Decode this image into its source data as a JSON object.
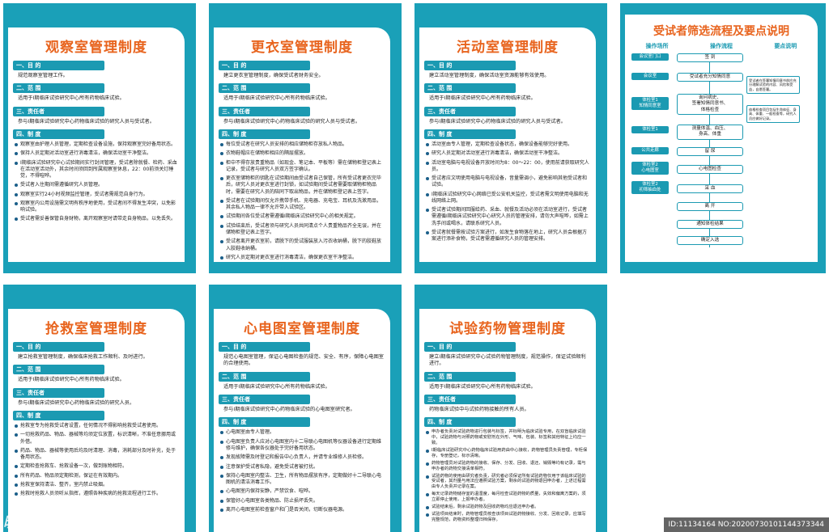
{
  "boards": [
    {
      "title": "观察室管理制度",
      "sections": [
        {
          "head": "一、目 的",
          "text": "规范观察室管理工作。"
        },
        {
          "head": "二、范 围",
          "text": "适用于I期临床试验研究中心所有药物临床试验。"
        },
        {
          "head": "三、责任者",
          "text": "参与I期临床试验研究中心药物临床试验的研究人员与受试者。"
        },
        {
          "head": "四、制 度",
          "text": ""
        }
      ],
      "bullets": [
        "观察室由护理人员管理，定期检查设备设施，保持观察室完好备用状态。",
        "保持人员定期对活动室进行消毒清洁，确保活动室干净整洁。",
        "I期临床试验研究中心试验期间实行封闭管理，受试者除就餐、检药、采血在活动室活动外，其余时间须回到所属观察室休息，22：00前须关灯睡觉，不得喧哗。",
        "受试者入住期间需遵循研究人员管理。",
        "观察室实行24小时视频监控管理，受试者需规范自身行为。",
        "观察室内公用设施需文明有秩序地使用，受试者间不得发生冲突，以免影响试验。",
        "受试者需妥善保管自身财物，离开观察室时请带走自身物品，以免丢失。"
      ]
    },
    {
      "title": "更衣室管理制度",
      "sections": [
        {
          "head": "一、目 的",
          "text": "建立更衣室管理制度，确保受试者财务安全。"
        },
        {
          "head": "二、范 围",
          "text": "适用于I期临床试验研究中心所有药物临床试验。"
        },
        {
          "head": "三、责任者",
          "text": "参与I期临床试验研究中心药物临床试验的研究人员与受试者。"
        },
        {
          "head": "四、制 度",
          "text": ""
        }
      ],
      "bullets": [
        "每位受试者在研究人员安排的相应储物柜存放私人物品。",
        "衣物鞋帽应在储物柜相应的隔层摆放。",
        "柜中不得存放贵重物品（如现金、笔记本、平板等）需在储物柜登记表上记录，受试者与研究人员双方签字确认。",
        "更衣室储物柜的钥匙在试验期间由受试者自己保管，所有受试者更衣完毕后，研究人员对更衣室进行封锁，如试验期间受试者需要取储物柜物品时，需要在研究人员的陪同下取出物品，并在储物柜登记表上签字。",
        "受试者在试验期间仅允许携带手机、充电器、充电宝、耳机及洗漱用品，其余私人物品一律不允许带入试验区。",
        "试验期间各位受试者需遵循I期临床试验研究中心的相关规定。",
        "试验结束后，受试者须与研究人员共同清点个人贵重物品齐全无误，并在储物柜登记表上签字。",
        "受试者离开更衣室前，请脱下的受试服装放入污衣收纳桶，脱下的胶鞋放入胶鞋收纳桶。",
        "研究人员定期对更衣室进行消毒清洁，确保更衣室干净整洁。"
      ]
    },
    {
      "title": "活动室管理制度",
      "sections": [
        {
          "head": "一、目 的",
          "text": "建立活动室管理制度，确保活动室资源能够有效使用。"
        },
        {
          "head": "二、范 围",
          "text": "适用于I期临床试验研究中心所有药物临床试验。"
        },
        {
          "head": "三、责任者",
          "text": "参与I期临床试验研究中心药物临床试验的研究人员与受试者。"
        },
        {
          "head": "四、制 度",
          "text": ""
        }
      ],
      "bullets": [
        "活动室由专人管理，定期检查设备状态，确保设备能够完好使用。",
        "研究人员定期对活动室进行消毒清洁，确保活动室干净整洁。",
        "活动室电脑与电视设备开放时间为8：00～22：00，使用前请获取研究人员。",
        "受试者应文明使用电脑与电视设备，音量需调小，避免影响其他受试者和试验。",
        "I期临床试验研究中心网络已受公安机关监控，受试者需文明使用电脑和无线网络上网。",
        "受试者试验期间回服给药、采血、就餐及活动必须在活动室进行，受试者需遵循I期临床试验研究中心研究人员的管理安排，请勿大声喧哗，如需上洗手间或喝水，请联系研究人员。",
        "受试者就餐需按试验方案进行，如发生食物落在地上，研究人员会根据方案进行添补食物，受试者需遵循研究人员的管理安排。"
      ]
    },
    {
      "title": "抢救室管理制度",
      "sections": [
        {
          "head": "一、目 的",
          "text": "建立抢救室管理制度，确保临床抢救工作顺利、及时进行。"
        },
        {
          "head": "二、范 围",
          "text": "适用于I期临床试验研究中心所有药物临床试验。"
        },
        {
          "head": "三、责任者",
          "text": "参与I期临床试验研究中心药物临床试验的研究人员。"
        },
        {
          "head": "四、制 度",
          "text": ""
        }
      ],
      "bullets": [
        "抢救室专为抢救受试者设置，任何情况不得影响抢救受试者使用。",
        "一切抢救药品、物品、器械等均须定位放置，标识清晰，不准任意挪用或外借。",
        "药品、物品、器械等使用后均及时清理、消毒，消耗部分及时补充，处于备用状态。",
        "定期检查抢救车、抢救设备一次，做到账物相符。",
        "所有药品、物品须定期检测，保证在有效期内。",
        "抢救室保持清洁、整齐，室内禁止吸烟。",
        "抢救时抢救人员须听从指挥，遵照各种疾病的抢救流程进行工作。"
      ]
    },
    {
      "title": "心电图室管理制度",
      "sections": [
        {
          "head": "一、目 的",
          "text": "规范心电图室管理，保证心电图检查的规范、安全、有序，保障心电图室的合理使用。"
        },
        {
          "head": "二、范 围",
          "text": "适用于I期临床试验研究中心所有药物临床试验。"
        },
        {
          "head": "三、责任者",
          "text": "参与I期临床试验研究中心药物临床试验的心电图室研究者。"
        },
        {
          "head": "四、制 度",
          "text": ""
        }
      ],
      "bullets": [
        "心电图室由专人管理。",
        "心电图室负责人应对心电图室内十二导联心电图机等仪器设备进行定期维修与维护，确保各仪器处于完好备用状态。",
        "发现故障需及时登记和报告中心负责人，并请专业维修人员检修。",
        "注意保护受试者私隐，避免受试者被打扰。",
        "保持心电图室内整洁、卫生，所有物品摆放有序，定期做好十二导联心电图机的清洁消毒工作。",
        "心电图室内保持安静，严禁饮食、喧哗。",
        "保管好心电图室各类物品、防止损坏丢失。",
        "离开心电图室前检查窗户和门是否关闭，切断仪器电源。"
      ]
    },
    {
      "title": "试验药物管理制度",
      "sections": [
        {
          "head": "一、目 的",
          "text": "建立I期临床试验研究中心试验药物管理制度，规范操作，保证试验顺利进行。"
        },
        {
          "head": "二、范 围",
          "text": "适用于I期临床试验研究中心所有药物临床试验。"
        },
        {
          "head": "三、责任者",
          "text": "药物临床试验中与试验药物接触的所有人员。"
        },
        {
          "head": "四、制 度",
          "text": ""
        }
      ],
      "bullets": [
        "申办者负责对试验药物进行包装与标签，并标明为临床试验专用，在双盲临床试验中，试验药物与对照药物或安慰剂在外形、气味、包装、标签和其他特征上均应一致。",
        "I期临床试验研究中心药物临床试验用药由中心接收，药物管理员负责管理，专柜保存，专册登记，标示清晰。",
        "药物管理员对试验药物的接收、保存、分发、回收、退还、销毁等均有记录，需与申办者的药物交接清单相符。",
        "试验药物的使用由研究者负责，研究者必须保证所有试验药物仅用于该临床试验的受试者，其剂量与用法应遵照试验方案，剩余的试验药物退回申办者，上述过程需由专人负责并记录在案。",
        "每天记录药物储存室的温湿度，每月检查试验药物的质量，失效和偏离方案的，须立即停止使用，上报申办者。",
        "试验结束后，剩余试验药物及回收药物均应退还申办者。",
        "试验项目结束时，药物管理员核查该项目试验药物接收、分发、回收记录，应填写完整规范，药物资料整理归档保存。"
      ]
    }
  ],
  "flow": {
    "title": "受试者筛选流程及要点说明",
    "columns": [
      "操作场所",
      "操作流程",
      "要点说明"
    ],
    "places": [
      "会议室门口",
      "会议室",
      "体检室1\n知情同意室",
      "体检室1",
      "公共走廊",
      "体检室2\n心电图室",
      "体检室2\n初筛抽血处"
    ],
    "steps": [
      "签 到",
      "受试者充分知情同意",
      "询问病史、\n签署知情同意书、\n体格检查",
      "测量体温、血压、\n身高、体重",
      "留 尿",
      "心电图检查",
      "采 血",
      "离 开",
      "通知体检结果",
      "确定入选"
    ],
    "notes": [
      "受试者在签署知情同意书前应充分理解试验的内容、风险和受益，自愿签署。",
      "体格检查项目包括生命体征、身高、体重、一般检查等，研究人员应做好记录。"
    ]
  },
  "watermark": {
    "logo": "昵图网",
    "info": "ID:11134164 NO:20200730101144373344"
  }
}
